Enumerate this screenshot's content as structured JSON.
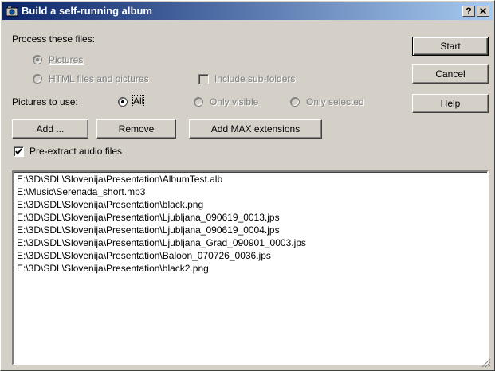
{
  "window": {
    "title": "Build a self-running album",
    "help_btn": "?",
    "close_btn": "✕"
  },
  "process": {
    "label": "Process these files:",
    "pictures": "Pictures",
    "html": "HTML files and pictures",
    "subfolders": "Include sub-folders"
  },
  "pictures_to_use": {
    "label": "Pictures to use:",
    "all": "All",
    "visible": "Only visible",
    "selected": "Only selected"
  },
  "buttons": {
    "add": "Add ...",
    "remove": "Remove",
    "add_max": "Add MAX extensions",
    "start": "Start",
    "cancel": "Cancel",
    "help": "Help"
  },
  "preextract": "Pre-extract audio files",
  "files": [
    "E:\\3D\\SDL\\Slovenija\\Presentation\\AlbumTest.alb",
    "E:\\Music\\Serenada_short.mp3",
    "E:\\3D\\SDL\\Slovenija\\Presentation\\black.png",
    "E:\\3D\\SDL\\Slovenija\\Presentation\\Ljubljana_090619_0013.jps",
    "E:\\3D\\SDL\\Slovenija\\Presentation\\Ljubljana_090619_0004.jps",
    "E:\\3D\\SDL\\Slovenija\\Presentation\\Ljubljana_Grad_090901_0003.jps",
    "E:\\3D\\SDL\\Slovenija\\Presentation\\Baloon_070726_0036.jps",
    "E:\\3D\\SDL\\Slovenija\\Presentation\\black2.png"
  ]
}
